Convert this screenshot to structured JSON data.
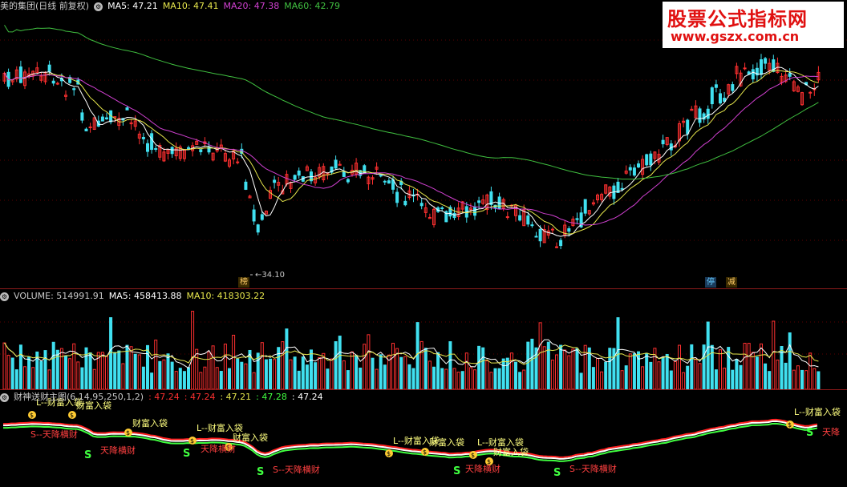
{
  "price_header": {
    "title": "美的集团(日线 前复权)",
    "ma5_label": "MA5: 47.21",
    "ma10_label": "MA10: 47.41",
    "ma20_label": "MA20: 47.38",
    "ma60_label": "MA60: 42.79",
    "colors": {
      "title": "#c8c8c8",
      "ma5": "#ffffff",
      "ma10": "#e6e64c",
      "ma20": "#d040d0",
      "ma60": "#40c040"
    }
  },
  "watermark": {
    "title": "股票公式指标网",
    "url": "www.gszx.com.cn"
  },
  "price_chart": {
    "low_label": "34.10",
    "badge_bang": "榜",
    "badge_ting": "停",
    "badge_jian": "减"
  },
  "volume_header": {
    "volume_label": "VOLUME: 514991.91",
    "ma5_label": "MA5: 458413.88",
    "ma10_label": "MA10: 418303.22"
  },
  "indicator_header": {
    "title": "财神送财主图(6,14,95,250,1,2)",
    "v1": ": 47.24",
    "v2": ": 47.24",
    "v3": ": 47.21",
    "v4": ": 47.28",
    "v5": ": 47.24"
  },
  "signals": {
    "buy_label": "L--财富入袋",
    "buy_short": "财富入袋",
    "sell_label": "S--天降横财",
    "sell_short": "天降横财",
    "sell_tag": "天降横财",
    "sell_tag_short": "天降"
  }
}
